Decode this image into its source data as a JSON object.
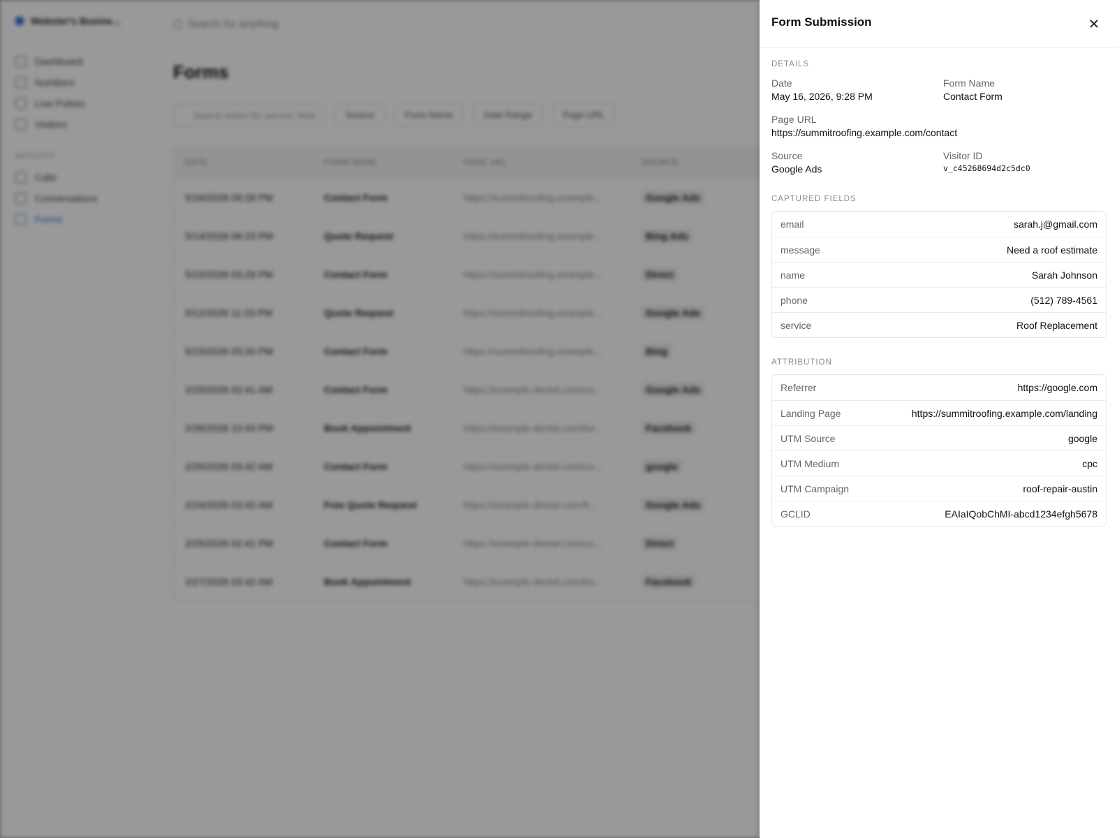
{
  "background": {
    "workspace": "Webster's Busine...",
    "search_placeholder": "Search for anything",
    "nav": [
      "Dashboard",
      "Numbers",
      "Live Pulses",
      "Visitors"
    ],
    "nav_section": "ACTIVITY",
    "nav_activity": [
      "Calls",
      "Conversations",
      "Forms"
    ],
    "page_title": "Forms",
    "filter_search": "Search visitor ID, person, field...",
    "filters": [
      "Source",
      "Form Name",
      "Date Range",
      "Page URL"
    ],
    "columns": [
      "DATE",
      "FORM NAME",
      "PAGE URL",
      "SOURCE"
    ],
    "rows": [
      {
        "date": "5/16/2026 09:28 PM",
        "form": "Contact Form",
        "url": "https://summitroofing.example...",
        "source": "Google Ads"
      },
      {
        "date": "5/14/2026 06:23 PM",
        "form": "Quote Request",
        "url": "https://summitroofing.example...",
        "source": "Bing Ads"
      },
      {
        "date": "5/15/2026 03:29 PM",
        "form": "Contact Form",
        "url": "https://summitroofing.example...",
        "source": "Direct"
      },
      {
        "date": "5/12/2026 11:23 PM",
        "form": "Quote Request",
        "url": "https://summitroofing.example...",
        "source": "Google Ads"
      },
      {
        "date": "5/15/2026 05:20 PM",
        "form": "Contact Form",
        "url": "https://summitroofing.example...",
        "source": "Bing"
      },
      {
        "date": "2/25/2026 02:41 AM",
        "form": "Contact Form",
        "url": "https://example-dental.com/co...",
        "source": "Google Ads"
      },
      {
        "date": "2/26/2026 10:43 PM",
        "form": "Book Appointment",
        "url": "https://example-dental.com/bo...",
        "source": "Facebook"
      },
      {
        "date": "2/25/2026 03:42 AM",
        "form": "Contact Form",
        "url": "https://example-dental.com/co...",
        "source": "google"
      },
      {
        "date": "2/24/2026 03:42 AM",
        "form": "Free Quote Request",
        "url": "https://example-dental.com/fr...",
        "source": "Google Ads"
      },
      {
        "date": "2/25/2026 02:41 PM",
        "form": "Contact Form",
        "url": "https://example-dental.com/co...",
        "source": "Direct"
      },
      {
        "date": "2/27/2026 03:42 AM",
        "form": "Book Appointment",
        "url": "https://example-dental.com/bo...",
        "source": "Facebook"
      }
    ]
  },
  "drawer": {
    "title": "Form Submission",
    "details_label": "DETAILS",
    "date_label": "Date",
    "date_value": "May 16, 2026, 9:28 PM",
    "form_name_label": "Form Name",
    "form_name_value": "Contact Form",
    "page_url_label": "Page URL",
    "page_url_value": "https://summitroofing.example.com/contact",
    "source_label": "Source",
    "source_value": "Google Ads",
    "visitor_id_label": "Visitor ID",
    "visitor_id_value": "v_c45268694d2c5dc0",
    "captured_label": "CAPTURED FIELDS",
    "captured": [
      {
        "key": "email",
        "value": "sarah.j@gmail.com"
      },
      {
        "key": "message",
        "value": "Need a roof estimate"
      },
      {
        "key": "name",
        "value": "Sarah Johnson"
      },
      {
        "key": "phone",
        "value": "(512) 789-4561"
      },
      {
        "key": "service",
        "value": "Roof Replacement"
      }
    ],
    "attribution_label": "ATTRIBUTION",
    "attribution": [
      {
        "key": "Referrer",
        "value": "https://google.com"
      },
      {
        "key": "Landing Page",
        "value": "https://summitroofing.example.com/landing"
      },
      {
        "key": "UTM Source",
        "value": "google"
      },
      {
        "key": "UTM Medium",
        "value": "cpc"
      },
      {
        "key": "UTM Campaign",
        "value": "roof-repair-austin"
      },
      {
        "key": "GCLID",
        "value": "EAIaIQobChMI-abcd1234efgh5678"
      }
    ]
  }
}
